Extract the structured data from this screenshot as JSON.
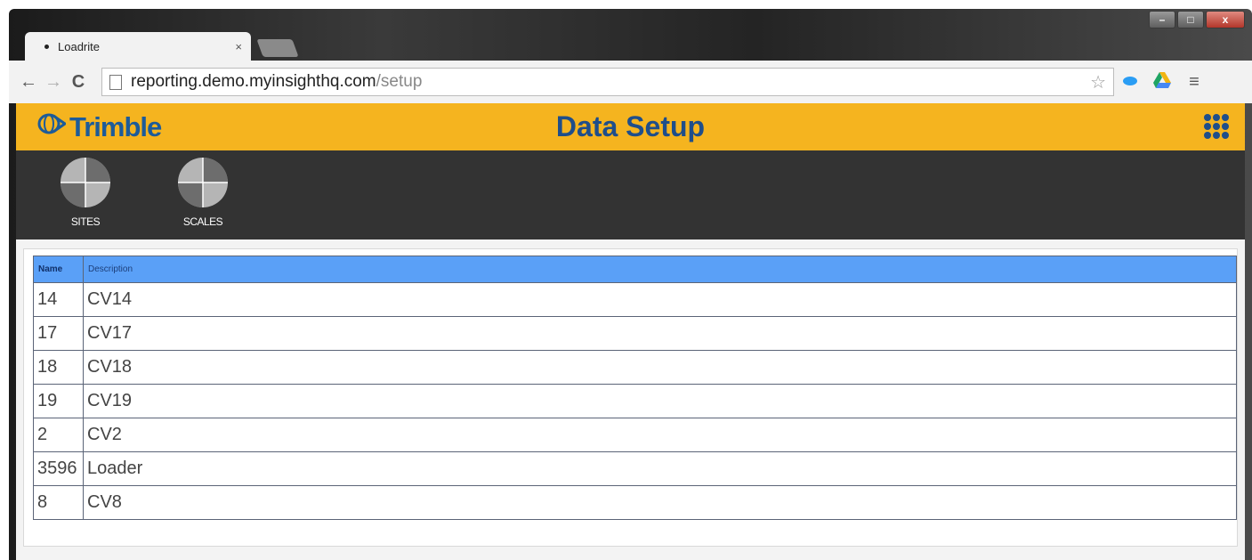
{
  "browser": {
    "tab_title": "Loadrite",
    "tab_close": "×",
    "url_host": "reporting.demo.myinsighthq.com",
    "url_path": "/setup",
    "back_glyph": "←",
    "forward_glyph": "→",
    "reload_glyph": "C",
    "star_glyph": "☆",
    "menu_glyph": "≡",
    "window_buttons": {
      "minimize": "–",
      "maximize": "□",
      "close": "x"
    }
  },
  "header": {
    "logo_text": "Trimble",
    "title": "Data Setup",
    "accent_color": "#f5b41f",
    "title_color": "#1f4e8a"
  },
  "nav": {
    "items": [
      {
        "label": "SITES",
        "icon": "pie-quadrant-icon"
      },
      {
        "label": "SCALES",
        "icon": "pie-quadrant-icon"
      }
    ]
  },
  "table": {
    "columns": [
      "Name",
      "Description"
    ],
    "rows": [
      [
        "14",
        "CV14"
      ],
      [
        "17",
        "CV17"
      ],
      [
        "18",
        "CV18"
      ],
      [
        "19",
        "CV19"
      ],
      [
        "2",
        "CV2"
      ],
      [
        "3596",
        "Loader"
      ],
      [
        "8",
        "CV8"
      ]
    ],
    "header_color": "#5aa0f7"
  }
}
